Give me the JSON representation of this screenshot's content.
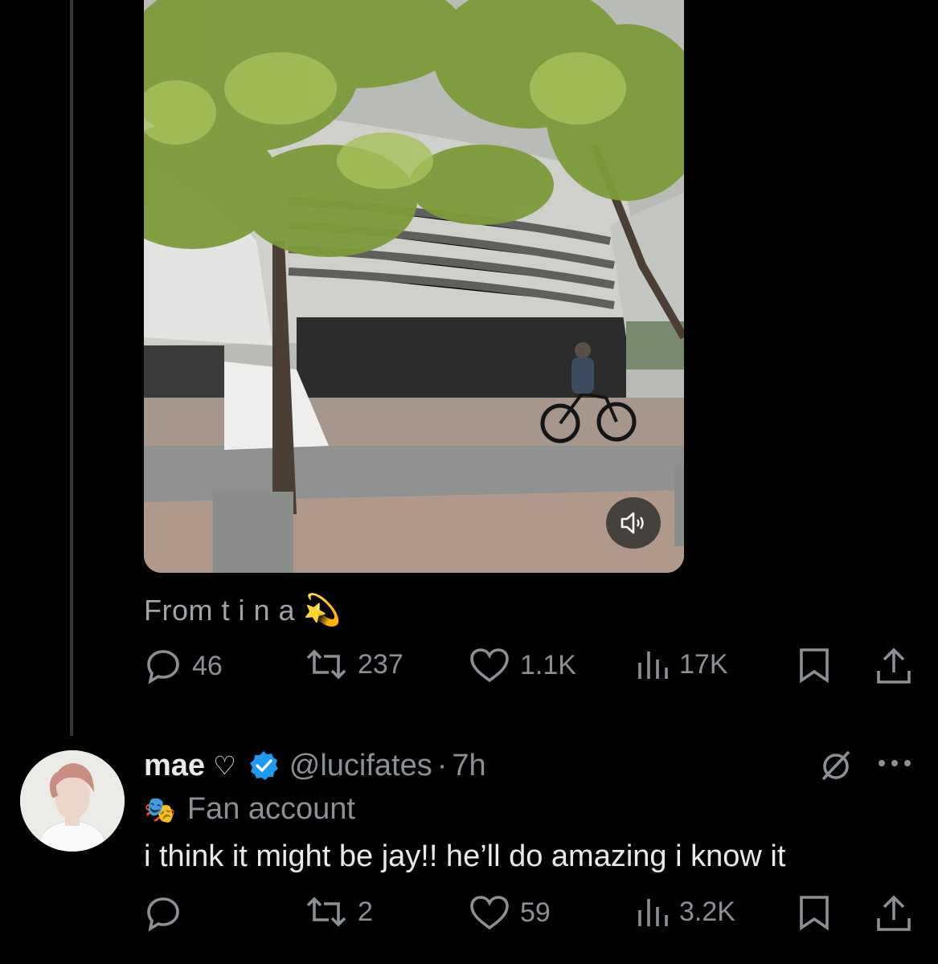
{
  "tweet": {
    "caption_text": "From t i n a",
    "caption_emoji": "💫",
    "stats": {
      "replies": "46",
      "reposts": "237",
      "likes": "1.1K",
      "views": "17K"
    }
  },
  "reply": {
    "display_name": "mae",
    "name_symbol": "♡",
    "handle": "@lucifates",
    "separator": "·",
    "time": "7h",
    "label_icon": "theater-mask-emoji",
    "label_emoji": "🎭",
    "label_text": "Fan account",
    "text": "i think it might be jay!! he’ll do amazing i know it",
    "stats": {
      "replies": "",
      "reposts": "2",
      "likes": "59",
      "views": "3.2K"
    }
  },
  "colors": {
    "background": "#000000",
    "text_primary": "#e7e9ea",
    "text_secondary": "#8b9096",
    "verified_blue": "#1d9bf0",
    "thread_line": "#333639"
  },
  "icons": [
    "reply-icon",
    "repost-icon",
    "like-icon",
    "views-icon",
    "bookmark-icon",
    "share-icon",
    "speaker-icon",
    "verified-badge-icon",
    "grok-slash-icon",
    "more-icon"
  ]
}
